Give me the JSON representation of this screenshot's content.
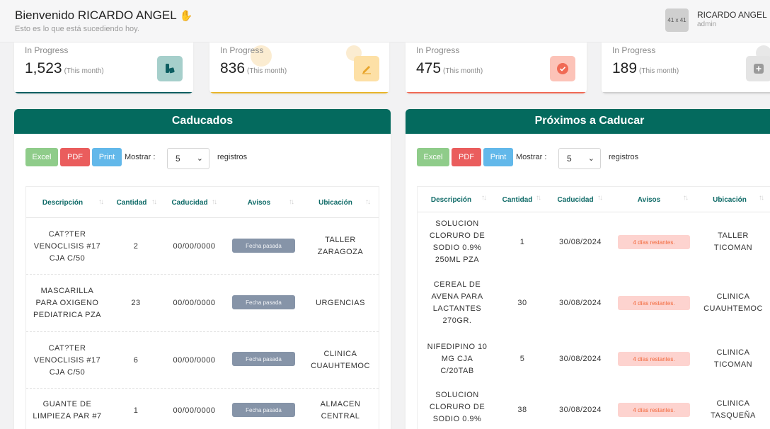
{
  "header": {
    "greeting": "Bienvenido RICARDO ANGEL",
    "subtitle": "Esto es lo que está sucediendo hoy.",
    "avatar_text": "41 x 41",
    "user_name": "RICARDO ANGEL",
    "user_role": "admin"
  },
  "stats": [
    {
      "label": "In Progress",
      "value": "1,523",
      "period": "(This month)",
      "icon": "bookmark-icon",
      "color": "#0d5e61"
    },
    {
      "label": "In Progress",
      "value": "836",
      "period": "(This month)",
      "icon": "pencil-icon",
      "color": "#e8b52a"
    },
    {
      "label": "In Progress",
      "value": "475",
      "period": "(This month)",
      "icon": "check-circle-icon",
      "color": "#f06a55"
    },
    {
      "label": "In Progress",
      "value": "189",
      "period": "(This month)",
      "icon": "plus-icon",
      "color": "#aaaaaa"
    }
  ],
  "caducados": {
    "title": "Caducados",
    "buttons": {
      "excel": "Excel",
      "pdf": "PDF",
      "print": "Print"
    },
    "show_label": "Mostrar :",
    "show_value": "5",
    "records_label": "registros",
    "columns": [
      "Descripción",
      "Cantidad",
      "Caducidad",
      "Avisos",
      "Ubicación"
    ],
    "rows": [
      {
        "desc": [
          "CAT?TER",
          "VENOCLISIS #17",
          "CJA C/50"
        ],
        "qty": "2",
        "date": "00/00/0000",
        "notice": "Fecha pasada",
        "loc": [
          "TALLER",
          "ZARAGOZA"
        ]
      },
      {
        "desc": [
          "MASCARILLA",
          "PARA OXIGENO",
          "PEDIATRICA PZA"
        ],
        "qty": "23",
        "date": "00/00/0000",
        "notice": "Fecha pasada",
        "loc": [
          "URGENCIAS"
        ]
      },
      {
        "desc": [
          "CAT?TER",
          "VENOCLISIS #17",
          "CJA C/50"
        ],
        "qty": "6",
        "date": "00/00/0000",
        "notice": "Fecha pasada",
        "loc": [
          "CLINICA",
          "CUAUHTEMOC"
        ]
      },
      {
        "desc": [
          "GUANTE DE",
          "LIMPIEZA PAR #7"
        ],
        "qty": "1",
        "date": "00/00/0000",
        "notice": "Fecha pasada",
        "loc": [
          "ALMACEN",
          "CENTRAL"
        ]
      }
    ]
  },
  "proximos": {
    "title": "Próximos a Caducar",
    "buttons": {
      "excel": "Excel",
      "pdf": "PDF",
      "print": "Print"
    },
    "show_label": "Mostrar :",
    "show_value": "5",
    "records_label": "registros",
    "columns": [
      "Descripción",
      "Cantidad",
      "Caducidad",
      "Avisos",
      "Ubicación"
    ],
    "rows": [
      {
        "desc": [
          "SOLUCION",
          "CLORURO DE",
          "SODIO 0.9%",
          "250ML PZA"
        ],
        "qty": "1",
        "date": "30/08/2024",
        "notice": "4 días restantes.",
        "loc": [
          "TALLER",
          "TICOMAN"
        ]
      },
      {
        "desc": [
          "CEREAL DE",
          "AVENA PARA",
          "LACTANTES",
          "270GR."
        ],
        "qty": "30",
        "date": "30/08/2024",
        "notice": "4 días restantes.",
        "loc": [
          "CLINICA",
          "CUAUHTEMOC"
        ]
      },
      {
        "desc": [
          "NIFEDIPINO 10",
          "MG CJA",
          "C/20TAB"
        ],
        "qty": "5",
        "date": "30/08/2024",
        "notice": "4 días restantes.",
        "loc": [
          "CLINICA",
          "TICOMAN"
        ]
      },
      {
        "desc": [
          "SOLUCION",
          "CLORURO DE",
          "SODIO 0.9%"
        ],
        "qty": "38",
        "date": "30/08/2024",
        "notice": "4 días restantes.",
        "loc": [
          "CLINICA",
          "TASQUEÑA"
        ]
      }
    ]
  }
}
